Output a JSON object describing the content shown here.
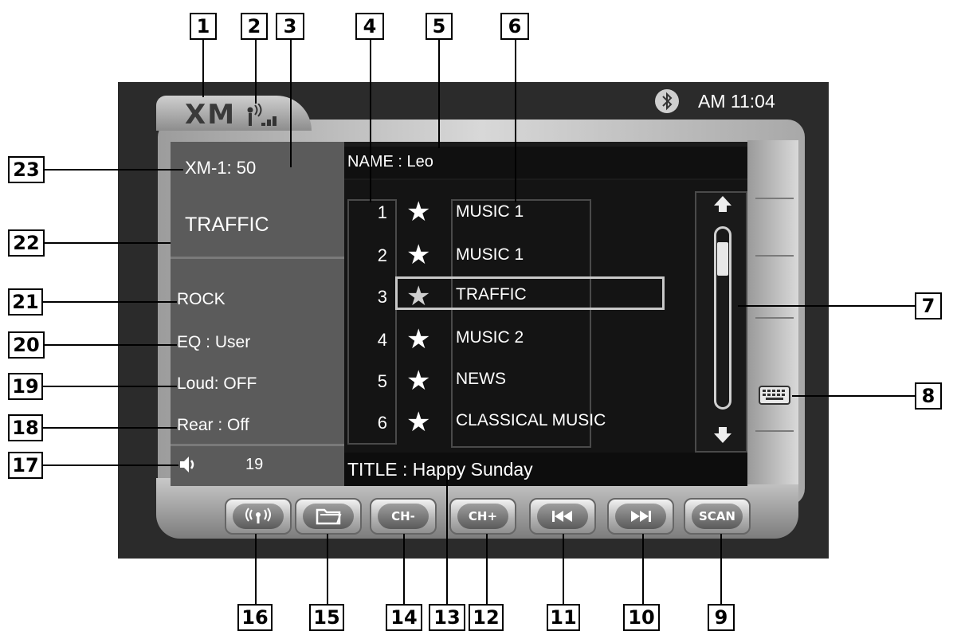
{
  "status": {
    "time": "AM 11:04",
    "bluetooth_icon": "bluetooth-icon",
    "logo": "XM"
  },
  "left_panel": {
    "channel": "XM-1:  50",
    "channel_name": "TRAFFIC",
    "category": "ROCK",
    "eq": "EQ  : User",
    "loud": "Loud: OFF",
    "rear": "Rear : Off",
    "volume": "19"
  },
  "header": {
    "name": "NAME : Leo"
  },
  "presets": [
    {
      "num": "1",
      "label": "MUSIC 1"
    },
    {
      "num": "2",
      "label": "MUSIC 1"
    },
    {
      "num": "3",
      "label": "TRAFFIC"
    },
    {
      "num": "4",
      "label": "MUSIC 2"
    },
    {
      "num": "5",
      "label": "NEWS"
    },
    {
      "num": "6",
      "label": "CLASSICAL MUSIC"
    }
  ],
  "selected_preset": "3",
  "footer": {
    "title": "TITLE : Happy Sunday"
  },
  "buttons": {
    "ch_minus": "CH-",
    "ch_plus": "CH+",
    "scan": "SCAN"
  },
  "callouts": {
    "c1": "1",
    "c2": "2",
    "c3": "3",
    "c4": "4",
    "c5": "5",
    "c6": "6",
    "c7": "7",
    "c8": "8",
    "c9": "9",
    "c10": "10",
    "c11": "11",
    "c12": "12",
    "c13": "13",
    "c14": "14",
    "c15": "15",
    "c16": "16",
    "c17": "17",
    "c18": "18",
    "c19": "19",
    "c20": "20",
    "c21": "21",
    "c22": "22",
    "c23": "23"
  }
}
